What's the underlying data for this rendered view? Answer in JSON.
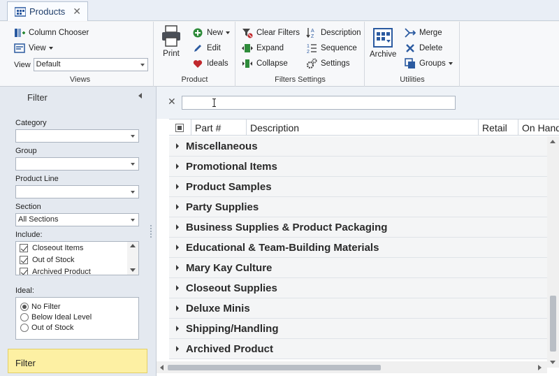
{
  "tabs": [
    {
      "label": "Products",
      "close": "✕"
    }
  ],
  "ribbon": {
    "views": {
      "title": "Views",
      "column_chooser": "Column Chooser",
      "view_menu": "View",
      "view_label": "View",
      "view_value": "Default"
    },
    "product": {
      "title": "Product",
      "print": "Print",
      "new": "New",
      "edit": "Edit",
      "ideals": "Ideals"
    },
    "filters_settings": {
      "title": "Filters Settings",
      "clear_filters": "Clear Filters",
      "expand": "Expand",
      "collapse": "Collapse",
      "description": "Description",
      "sequence": "Sequence",
      "settings": "Settings"
    },
    "utilities": {
      "title": "Utilities",
      "archive": "Archive",
      "merge": "Merge",
      "delete": "Delete",
      "groups": "Groups"
    }
  },
  "filter_panel": {
    "title": "Filter",
    "category_label": "Category",
    "category_value": "",
    "group_label": "Group",
    "group_value": "",
    "product_line_label": "Product Line",
    "product_line_value": "",
    "section_label": "Section",
    "section_value": "All Sections",
    "include_label": "Include:",
    "include_items": [
      {
        "label": "Closeout Items",
        "checked": true
      },
      {
        "label": "Out of Stock",
        "checked": true
      },
      {
        "label": "Archived Product",
        "checked": true
      }
    ],
    "ideal_label": "Ideal:",
    "ideal_options": [
      {
        "label": "No Filter",
        "selected": true
      },
      {
        "label": "Below Ideal Level",
        "selected": false
      },
      {
        "label": "Out of Stock",
        "selected": false
      }
    ],
    "filter_button": "Filter"
  },
  "search": {
    "close": "✕",
    "value": ""
  },
  "grid": {
    "columns": [
      "Part #",
      "Description",
      "Retail",
      "On Hand"
    ],
    "groups": [
      "Miscellaneous",
      "Promotional Items",
      "Product Samples",
      "Party Supplies",
      "Business Supplies & Product Packaging",
      "Educational & Team-Building Materials",
      "Mary Kay Culture",
      "Closeout Supplies",
      "Deluxe Minis",
      "Shipping/Handling",
      "Archived Product"
    ]
  },
  "colors": {
    "accent": "#1f3e6b",
    "filter_button_bg": "#fdf0a3",
    "panel_bg": "#e4e9f0"
  }
}
